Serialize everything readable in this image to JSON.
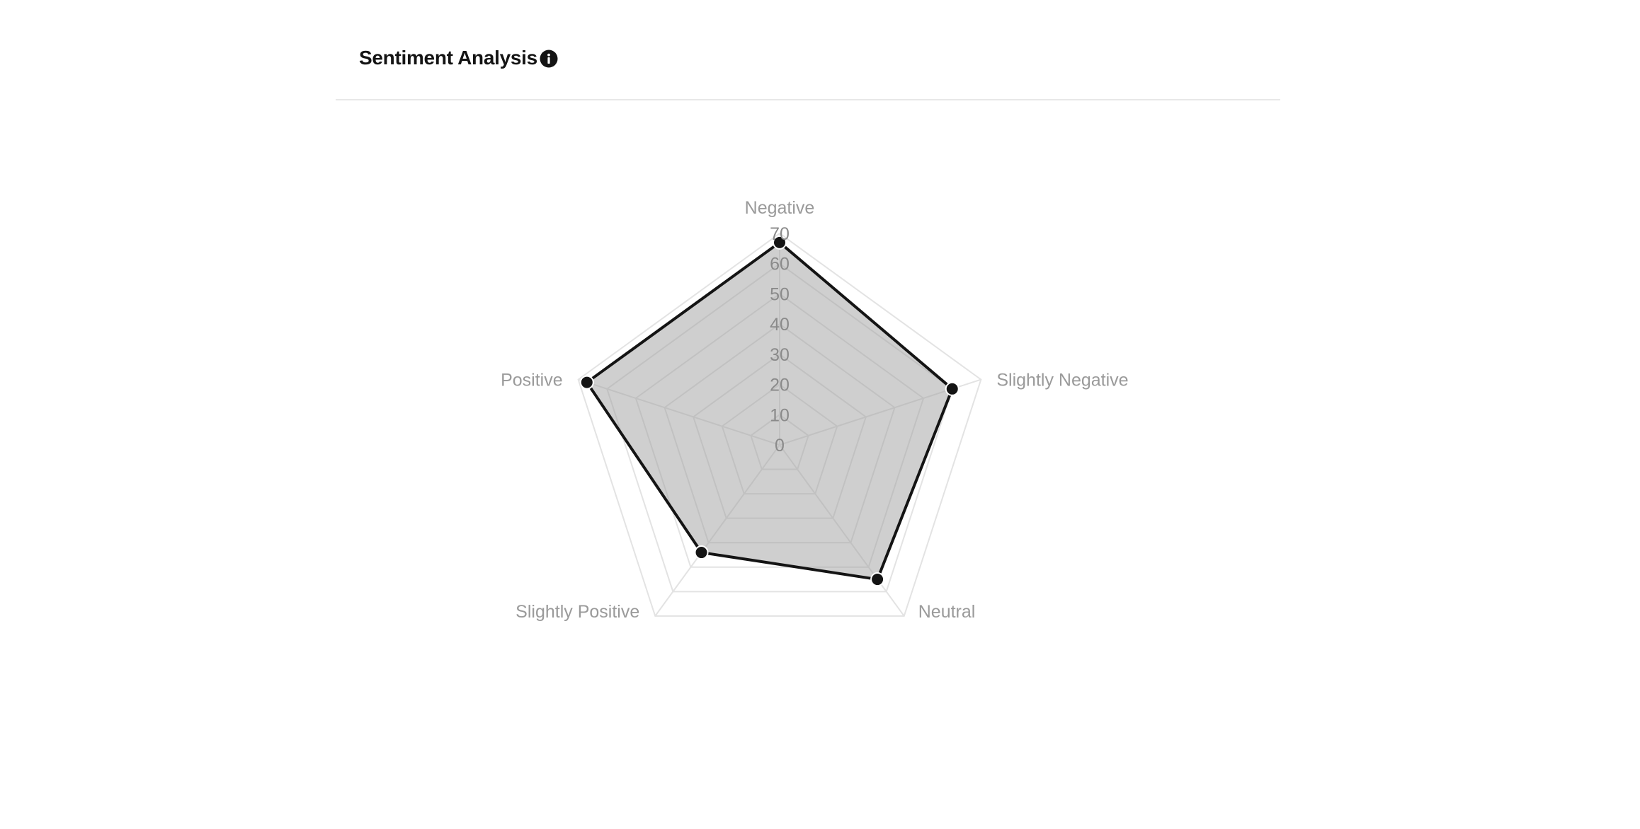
{
  "header": {
    "title": "Sentiment Analysis",
    "info_icon": "info-icon"
  },
  "colors": {
    "grid": "#e3e3e3",
    "fill": "rgba(160,160,160,0.5)",
    "stroke": "#141414",
    "point": "#141414"
  },
  "chart_data": {
    "type": "radar",
    "title": "",
    "categories": [
      "Negative",
      "Slightly Negative",
      "Neutral",
      "Slightly Positive",
      "Positive"
    ],
    "series": [
      {
        "values": [
          67,
          60,
          55,
          44,
          67
        ]
      }
    ],
    "rlim": [
      0,
      70
    ],
    "ticks": [
      "0",
      "10",
      "20",
      "30",
      "40",
      "50",
      "60",
      "70"
    ],
    "grid": true,
    "legend": "none"
  }
}
